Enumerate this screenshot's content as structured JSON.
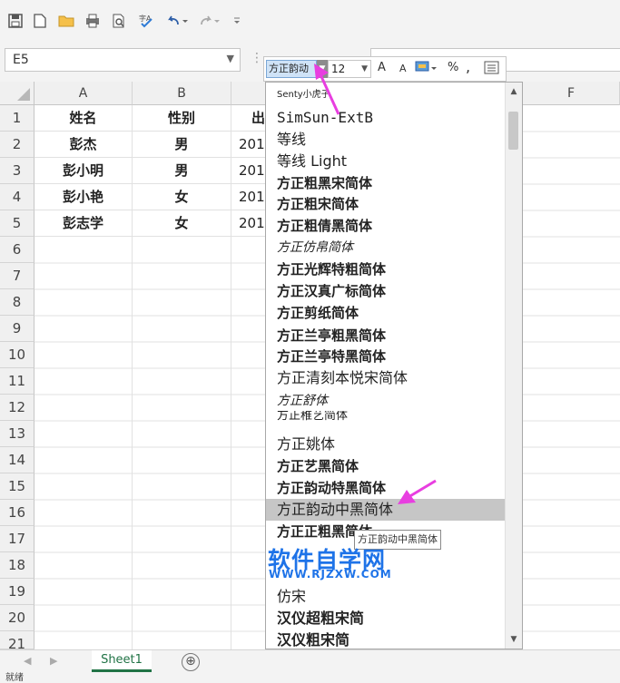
{
  "quick_access": {
    "icons": [
      "save-icon",
      "new-document-icon",
      "open-folder-icon",
      "print-preview-icon",
      "print-icon",
      "spelling-check-icon",
      "undo-icon",
      "redo-icon",
      "customize-icon"
    ]
  },
  "formula_bar": {
    "name_box": "E5",
    "formula_value": ""
  },
  "mini_toolbar": {
    "font_name": "方正韵动",
    "font_size": "12",
    "grow_font": "A",
    "shrink_font": "A",
    "percent": "%",
    "comma": ","
  },
  "columns": [
    "A",
    "B",
    "",
    "F"
  ],
  "rows": [
    "1",
    "2",
    "3",
    "4",
    "5",
    "6",
    "7",
    "8",
    "9",
    "10",
    "11",
    "12",
    "13",
    "14",
    "15",
    "16",
    "17",
    "18",
    "19",
    "20",
    "21"
  ],
  "table": {
    "header": [
      "姓名",
      "性别",
      "出"
    ],
    "data": [
      [
        "彭杰",
        "男",
        "201"
      ],
      [
        "彭小明",
        "男",
        "201"
      ],
      [
        "彭小艳",
        "女",
        "201"
      ],
      [
        "彭志学",
        "女",
        "201"
      ]
    ]
  },
  "font_list": [
    {
      "label": "Senty小虎子",
      "style": "small"
    },
    {
      "label": "SimSun-ExtB",
      "style": "normal"
    },
    {
      "label": "等线",
      "style": "normal"
    },
    {
      "label": "等线 Light",
      "style": "normal"
    },
    {
      "label": "方正粗黑宋简体",
      "style": "bold"
    },
    {
      "label": "方正粗宋简体",
      "style": "bold"
    },
    {
      "label": "方正粗倩黑简体",
      "style": "bold"
    },
    {
      "label": "方正仿帛简体",
      "style": "normal"
    },
    {
      "label": "方正光辉特粗简体",
      "style": "bold"
    },
    {
      "label": "方正汉真广标简体",
      "style": "bold"
    },
    {
      "label": "方正剪纸简体",
      "style": "bold"
    },
    {
      "label": "方正兰亭粗黑简体",
      "style": "bold"
    },
    {
      "label": "方正兰亭特黑简体",
      "style": "bold"
    },
    {
      "label": "方正清刻本悦宋简体",
      "style": "normal"
    },
    {
      "label": "方正舒体",
      "style": "normal"
    },
    {
      "label": "方正稚艺简体",
      "style": "normal"
    },
    {
      "label": "方正姚体",
      "style": "normal"
    },
    {
      "label": "方正艺黑简体",
      "style": "bold"
    },
    {
      "label": "方正韵动特黑简体",
      "style": "bold"
    },
    {
      "label": "方正韵动中黑简体",
      "style": "selected"
    },
    {
      "label": "方正正粗黑简体",
      "style": "bold"
    },
    {
      "label": "",
      "style": "normal"
    },
    {
      "label": "",
      "style": "normal"
    },
    {
      "label": "仿宋",
      "style": "normal"
    },
    {
      "label": "汉仪超粗宋简",
      "style": "bold"
    },
    {
      "label": "汉仪粗宋简",
      "style": "bold"
    }
  ],
  "tooltip": "方正韵动中黑简体",
  "watermark": {
    "title": "软件自学网",
    "url": "WWW.RJZXW.COM"
  },
  "sheet_tabs": {
    "active": "Sheet1",
    "add": "⊕"
  },
  "status_bar": "就绪",
  "colors": {
    "accent_green": "#217346",
    "arrow_magenta": "#e83ee0",
    "selection_gray": "#c6c6c6",
    "watermark_blue": "#1e73e8"
  }
}
